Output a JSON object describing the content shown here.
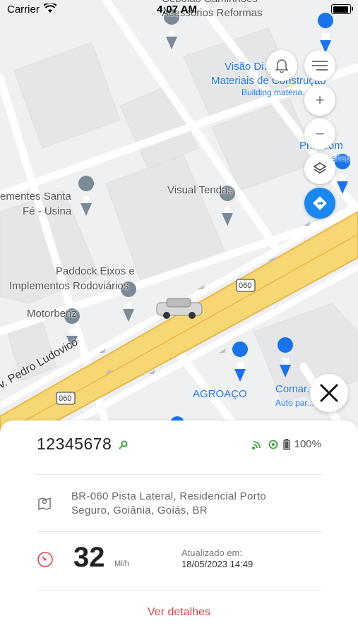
{
  "status_bar": {
    "carrier": "Carrier",
    "time": "4:07 AM"
  },
  "map": {
    "labels": {
      "cebolao": "Cebolão Caminhões",
      "acessorios": "Acessórios Reformas",
      "visao_line1": "Visão Di... de",
      "visao_line2": "Materiais de Construção",
      "visao_sub": "Building materia...",
      "prime_bom": "Pr... Bom",
      "prime_sub": "...shop",
      "cimentes_line1": "ementes Santa",
      "cimentes_line2": "Fé - Usina",
      "visual_tendas": "Visual Tendas",
      "paddock_line1": "Paddock Eixos e",
      "paddock_line2": "Implementos Rodoviários",
      "motorbenz": "Motorbenz",
      "agroaco": "AGROAÇO",
      "comar": "Comar...",
      "comar_sub": "Auto par...",
      "road": "v. Pedro Ludovico",
      "shield_060": "060"
    },
    "colors": {
      "road_yellow": "#f7d774",
      "road_edge": "#e6b84a",
      "accent_blue": "#1a88f0",
      "poi_blue": "#1a73e8"
    }
  },
  "controls": {
    "notifications_icon": "bell-icon",
    "menu_icon": "menu-icon",
    "zoom_in_label": "+",
    "zoom_out_label": "−",
    "layers_icon": "layers-icon",
    "directions_icon": "directions-icon",
    "close_icon": "close-icon"
  },
  "vehicle": {
    "plate": "12345678",
    "key_icon": "key-icon",
    "signal_icon": "signal-icon",
    "gps_icon": "gps-icon",
    "battery": "100%",
    "address": "BR-060 Pista Lateral, Residencial Porto Seguro, Goiânia, Goiás, BR",
    "speed": "32",
    "speed_unit": "Mi/h",
    "updated_label": "Atualizado em:",
    "updated_value": "18/05/2023 14:49",
    "details_link": "Ver detalhes",
    "colors": {
      "ok_green": "#3aa63a",
      "link_red": "#d64545",
      "speed_icon_red": "#d64545"
    }
  }
}
